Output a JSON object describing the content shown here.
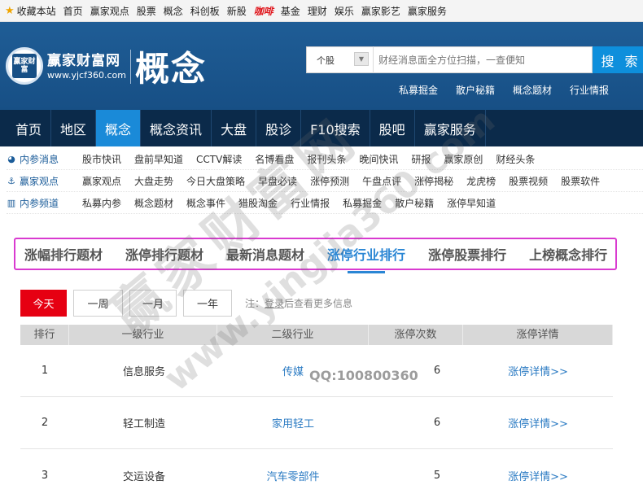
{
  "topbar": {
    "links": [
      "收藏本站",
      "首页",
      "赢家观点",
      "股票",
      "概念",
      "科创板",
      "新股",
      "咖啡",
      "基金",
      "理财",
      "娱乐",
      "赢家影艺",
      "赢家服务"
    ]
  },
  "header": {
    "logo_text": "赢家财富",
    "brand_name": "赢家财富网",
    "brand_url": "www.yjcf360.com",
    "page_title": "概念",
    "search": {
      "select_value": "个股",
      "placeholder": "财经消息面全方位扫描，一查便知",
      "button_label": "搜 索"
    },
    "quick_links": [
      "私募掘金",
      "散户秘籍",
      "概念题材",
      "行业情报"
    ]
  },
  "mainnav": {
    "items": [
      "首页",
      "地区",
      "概念",
      "概念资讯",
      "大盘",
      "股诊",
      "F10搜索",
      "股吧",
      "赢家服务"
    ],
    "active_index": 2
  },
  "subnav": {
    "rows": [
      {
        "category": "内参消息",
        "icon": "clock-icon",
        "links": [
          "股市快讯",
          "盘前早知道",
          "CCTV解读",
          "名博看盘",
          "报刊头条",
          "晚间快讯",
          "研报",
          "赢家原创",
          "财经头条"
        ]
      },
      {
        "category": "赢家观点",
        "icon": "anchor-icon",
        "links": [
          "赢家观点",
          "大盘走势",
          "今日大盘策略",
          "早盘必读",
          "涨停预测",
          "午盘点评",
          "涨停揭秘",
          "龙虎榜",
          "股票视频",
          "股票软件"
        ]
      },
      {
        "category": "内参频道",
        "icon": "bar-chart-icon",
        "links": [
          "私募内参",
          "概念题材",
          "概念事件",
          "猎股淘金",
          "行业情报",
          "私募掘金",
          "散户秘籍",
          "涨停早知道"
        ]
      }
    ]
  },
  "tabs": {
    "items": [
      "涨幅排行题材",
      "涨停排行题材",
      "最新消息题材",
      "涨停行业排行",
      "涨停股票排行",
      "上榜概念排行"
    ],
    "active_index": 3
  },
  "periods": {
    "buttons": [
      "今天",
      "一周",
      "一月",
      "一年"
    ],
    "active_index": 0,
    "note_prefix": "注：",
    "note_login": "登录",
    "note_suffix": "后查看更多信息"
  },
  "table": {
    "headers": [
      "排行",
      "一级行业",
      "二级行业",
      "涨停次数",
      "涨停详情"
    ],
    "rows": [
      {
        "rank": "1",
        "level1": "信息服务",
        "level2": "传媒",
        "count": "6",
        "detail": "涨停详情>>"
      },
      {
        "rank": "2",
        "level1": "轻工制造",
        "level2": "家用轻工",
        "count": "6",
        "detail": "涨停详情>>"
      },
      {
        "rank": "3",
        "level1": "交运设备",
        "level2": "汽车零部件",
        "count": "5",
        "detail": "涨停详情>>"
      }
    ]
  },
  "watermark": {
    "main": "赢家财富网",
    "url": "www.yingjia360.com",
    "qq": "QQ:100800360"
  }
}
